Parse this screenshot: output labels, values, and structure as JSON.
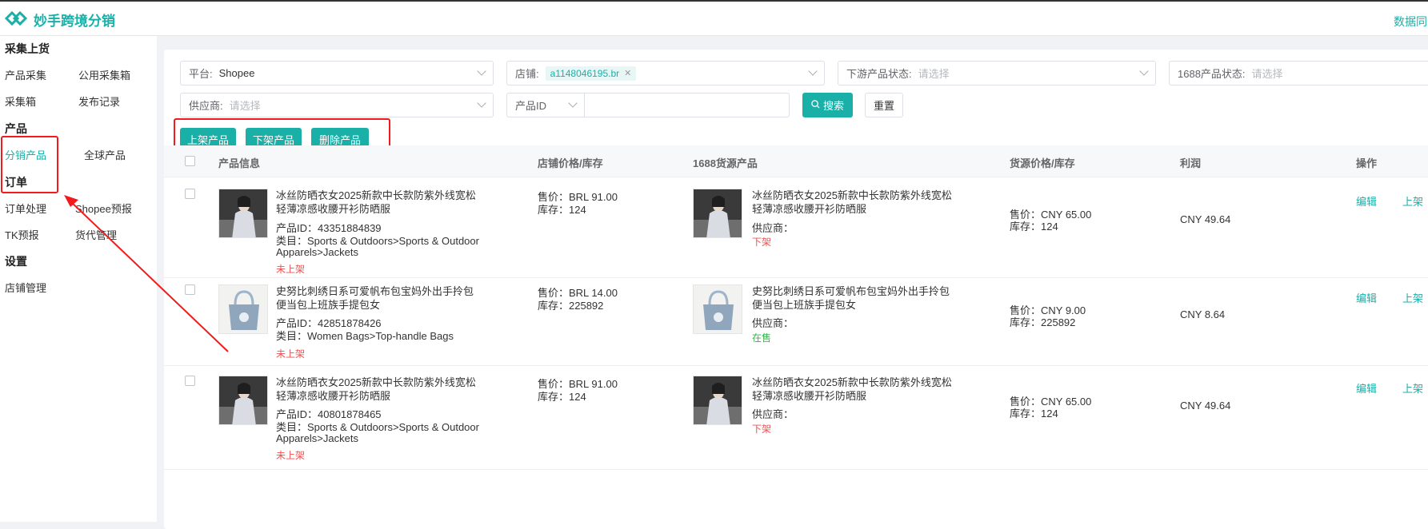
{
  "app": {
    "title": "妙手跨境分销",
    "top_right_link": "数据同步"
  },
  "sidebar": {
    "sections": [
      {
        "title": "采集上货",
        "items": [
          "产品采集",
          "公用采集箱",
          "采集箱",
          "发布记录"
        ]
      },
      {
        "title": "产品",
        "items": [
          "分销产品",
          "全球产品"
        ]
      },
      {
        "title": "订单",
        "items": [
          "订单处理",
          "Shopee预报",
          "TK预报",
          "货代管理"
        ]
      },
      {
        "title": "设置",
        "items": [
          "店铺管理"
        ]
      }
    ],
    "active_item": "分销产品"
  },
  "filters": {
    "platform": {
      "label": "平台:",
      "value": "Shopee"
    },
    "shop": {
      "label": "店铺:",
      "tag": "a1148046195.br"
    },
    "downstream_status": {
      "label": "下游产品状态:",
      "placeholder": "请选择"
    },
    "status_1688": {
      "label": "1688产品状态:",
      "placeholder": "请选择"
    },
    "supplier": {
      "label": "供应商:",
      "placeholder": "请选择"
    },
    "id_type": {
      "value": "产品ID"
    },
    "id_input": {
      "value": ""
    },
    "search_label": "搜索",
    "reset_label": "重置"
  },
  "actions": {
    "list_label": "上架产品",
    "delist_label": "下架产品",
    "delete_label": "删除产品"
  },
  "table": {
    "headers": [
      "产品信息",
      "店铺价格/库存",
      "1688货源产品",
      "货源价格/库存",
      "利润",
      "操作"
    ],
    "rows": [
      {
        "title": "冰丝防晒衣女2025新款中长款防紫外线宽松轻薄凉感收腰开衫防晒服",
        "product_id": "产品ID：43351884839",
        "category": "类目：Sports & Outdoors>Sports & Outdoor Apparels>Jackets",
        "status": "未上架",
        "shop_price": "售价：BRL 91.00",
        "shop_stock": "库存：124",
        "src_title": "冰丝防晒衣女2025新款中长款防紫外线宽松轻薄凉感收腰开衫防晒服",
        "src_supplier": "供应商：",
        "src_status": "下架",
        "src_price": "售价：CNY 65.00",
        "src_stock": "库存：124",
        "profit": "CNY 49.64",
        "edit": "编辑",
        "list": "上架"
      },
      {
        "title": "史努比刺绣日系可爱帆布包宝妈外出手拎包便当包上班族手提包女",
        "product_id": "产品ID：42851878426",
        "category": "类目：Women Bags>Top-handle Bags",
        "status": "未上架",
        "shop_price": "售价：BRL 14.00",
        "shop_stock": "库存：225892",
        "src_title": "史努比刺绣日系可爱帆布包宝妈外出手拎包便当包上班族手提包女",
        "src_supplier": "供应商：",
        "src_status": "在售",
        "src_price": "售价：CNY 9.00",
        "src_stock": "库存：225892",
        "profit": "CNY 8.64",
        "edit": "编辑",
        "list": "上架"
      },
      {
        "title": "冰丝防晒衣女2025新款中长款防紫外线宽松轻薄凉感收腰开衫防晒服",
        "product_id": "产品ID：40801878465",
        "category": "类目：Sports & Outdoors>Sports & Outdoor Apparels>Jackets",
        "status": "未上架",
        "shop_price": "售价：BRL 91.00",
        "shop_stock": "库存：124",
        "src_title": "冰丝防晒衣女2025新款中长款防紫外线宽松轻薄凉感收腰开衫防晒服",
        "src_supplier": "供应商：",
        "src_status": "下架",
        "src_price": "售价：CNY 65.00",
        "src_stock": "库存：124",
        "profit": "CNY 49.64",
        "edit": "编辑",
        "list": "上架"
      }
    ]
  },
  "colors": {
    "accent": "#1ab0a8",
    "annotation_red": "#f21b1b",
    "status_red": "#f05151",
    "status_green": "#33b34a"
  }
}
